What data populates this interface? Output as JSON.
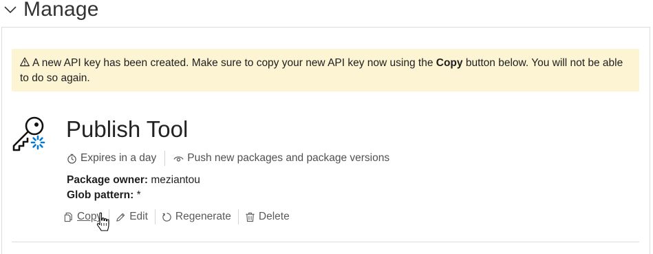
{
  "section": {
    "title": "Manage",
    "toggle_icon": "chevron-down-icon"
  },
  "alert": {
    "icon": "warning-icon",
    "text_before": "A new API key has been created. Make sure to copy your new API key now using the ",
    "bold": "Copy",
    "text_after": " button below. You will not be able to do so again."
  },
  "api_key": {
    "icon": "key-icon",
    "name": "Publish Tool",
    "expires": {
      "icon": "stopwatch-icon",
      "text": "Expires in a day"
    },
    "scope": {
      "icon": "eye-icon",
      "text": "Push new packages and package versions"
    },
    "owner_label": "Package owner:",
    "owner_value": "meziantou",
    "glob_label": "Glob pattern:",
    "glob_value": "*"
  },
  "actions": {
    "copy": {
      "label": "Copy",
      "icon": "copy-icon"
    },
    "edit": {
      "label": "Edit",
      "icon": "pencil-icon"
    },
    "regenerate": {
      "label": "Regenerate",
      "icon": "refresh-icon"
    },
    "delete": {
      "label": "Delete",
      "icon": "trash-icon"
    }
  },
  "colors": {
    "alert_bg": "#fcf4d2",
    "key_accent": "#0078d4",
    "border": "#dcdcdc"
  }
}
